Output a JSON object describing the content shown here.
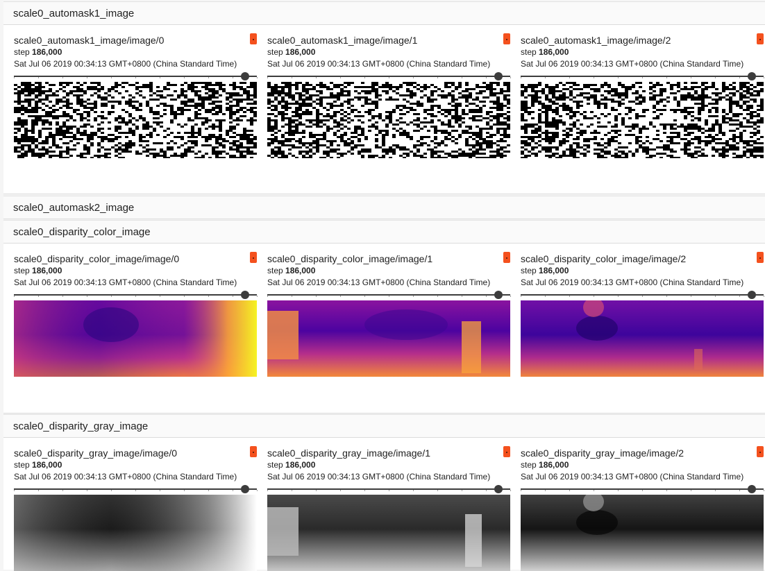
{
  "sections": [
    {
      "title": "scale0_automask1_image",
      "cards": [
        {
          "title": "scale0_automask1_image/image/0",
          "step_label": "step",
          "step": "186,000",
          "time": "Sat Jul 06 2019 00:34:13 GMT+0800 (China Standard Time)",
          "image": "binary-mask"
        },
        {
          "title": "scale0_automask1_image/image/1",
          "step_label": "step",
          "step": "186,000",
          "time": "Sat Jul 06 2019 00:34:13 GMT+0800 (China Standard Time)",
          "image": "binary-mask"
        },
        {
          "title": "scale0_automask1_image/image/2",
          "step_label": "step",
          "step": "186,000",
          "time": "Sat Jul 06 2019 00:34:13 GMT+0800 (China Standard Time)",
          "image": "binary-mask"
        }
      ]
    },
    {
      "title": "scale0_automask2_image",
      "cards": []
    },
    {
      "title": "scale0_disparity_color_image",
      "cards": [
        {
          "title": "scale0_disparity_color_image/image/0",
          "step_label": "step",
          "step": "186,000",
          "time": "Sat Jul 06 2019 00:34:13 GMT+0800 (China Standard Time)",
          "image": "disparity-plasma"
        },
        {
          "title": "scale0_disparity_color_image/image/1",
          "step_label": "step",
          "step": "186,000",
          "time": "Sat Jul 06 2019 00:34:13 GMT+0800 (China Standard Time)",
          "image": "disparity-plasma"
        },
        {
          "title": "scale0_disparity_color_image/image/2",
          "step_label": "step",
          "step": "186,000",
          "time": "Sat Jul 06 2019 00:34:13 GMT+0800 (China Standard Time)",
          "image": "disparity-plasma"
        }
      ]
    },
    {
      "title": "scale0_disparity_gray_image",
      "cards": [
        {
          "title": "scale0_disparity_gray_image/image/0",
          "step_label": "step",
          "step": "186,000",
          "time": "Sat Jul 06 2019 00:34:13 GMT+0800 (China Standard Time)",
          "image": "disparity-gray"
        },
        {
          "title": "scale0_disparity_gray_image/image/1",
          "step_label": "step",
          "step": "186,000",
          "time": "Sat Jul 06 2019 00:34:13 GMT+0800 (China Standard Time)",
          "image": "disparity-gray"
        },
        {
          "title": "scale0_disparity_gray_image/image/2",
          "step_label": "step",
          "step": "186,000",
          "time": "Sat Jul 06 2019 00:34:13 GMT+0800 (China Standard Time)",
          "image": "disparity-gray"
        }
      ]
    }
  ],
  "slider_position": 0.95,
  "colors": {
    "pin": "#f4511e",
    "slider": "#3c3c3c",
    "header_bg": "#fafafa",
    "body_bg": "#ffffff",
    "page_bg": "#f5f5f5"
  }
}
